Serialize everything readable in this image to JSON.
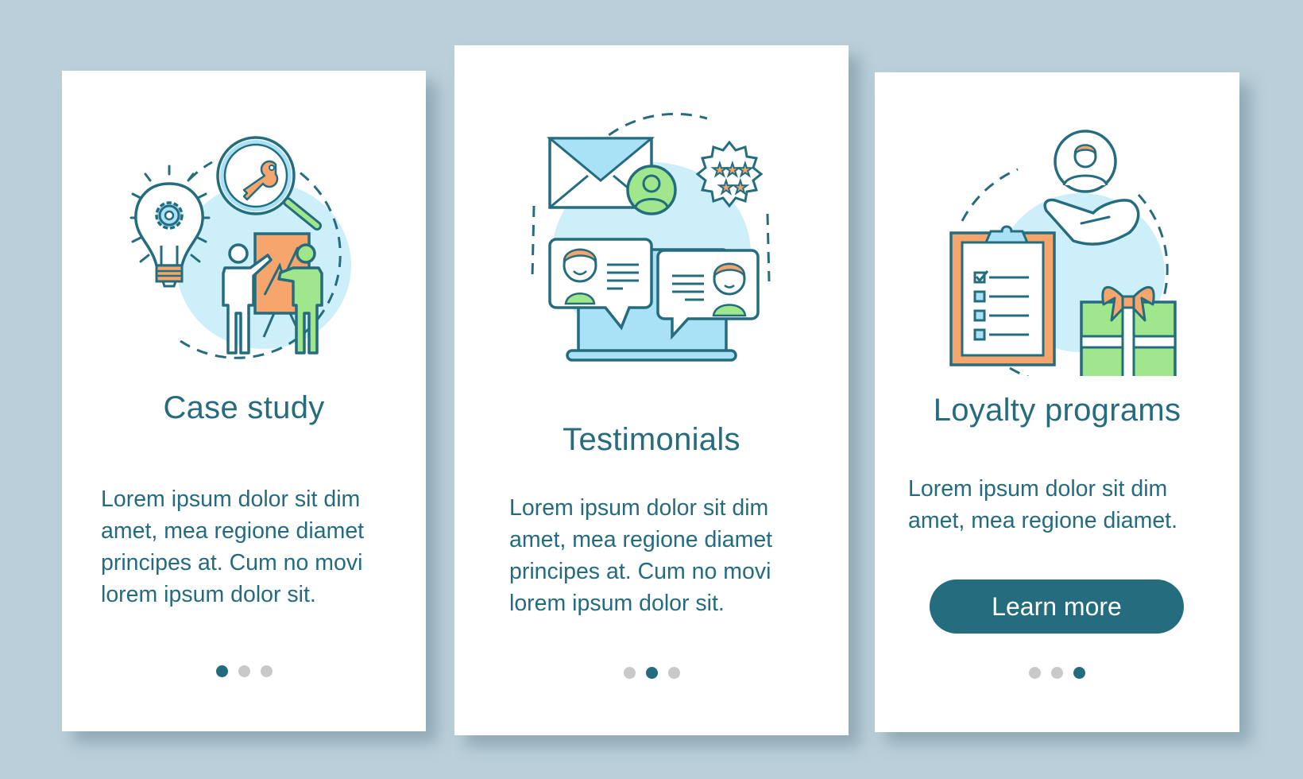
{
  "theme": {
    "background": "#bacfd9",
    "accent": "#246c7e",
    "text": "#256b7f",
    "dot_inactive": "#c9c9c9",
    "illustration_blue": "#a9e1f6",
    "illustration_orange": "#f6a66c",
    "illustration_green": "#a0e68c"
  },
  "screens": [
    {
      "title": "Case study",
      "illustration": "case-study-illustration",
      "body_lines": [
        "Lorem ipsum dolor sit dim",
        "amet, mea regione diamet",
        "principes at. Cum no movi",
        "lorem ipsum dolor sit."
      ],
      "pager": {
        "total": 3,
        "active": 1
      }
    },
    {
      "title": "Testimonials",
      "illustration": "testimonials-illustration",
      "body_lines": [
        "Lorem ipsum dolor sit dim",
        "amet, mea regione diamet",
        "principes at. Cum no movi",
        "lorem ipsum dolor sit."
      ],
      "pager": {
        "total": 3,
        "active": 2
      }
    },
    {
      "title": "Loyalty programs",
      "illustration": "loyalty-programs-illustration",
      "body_lines": [
        "Lorem ipsum dolor sit dim",
        "amet, mea regione diamet."
      ],
      "button": {
        "label": "Learn more"
      },
      "pager": {
        "total": 3,
        "active": 3
      }
    }
  ]
}
